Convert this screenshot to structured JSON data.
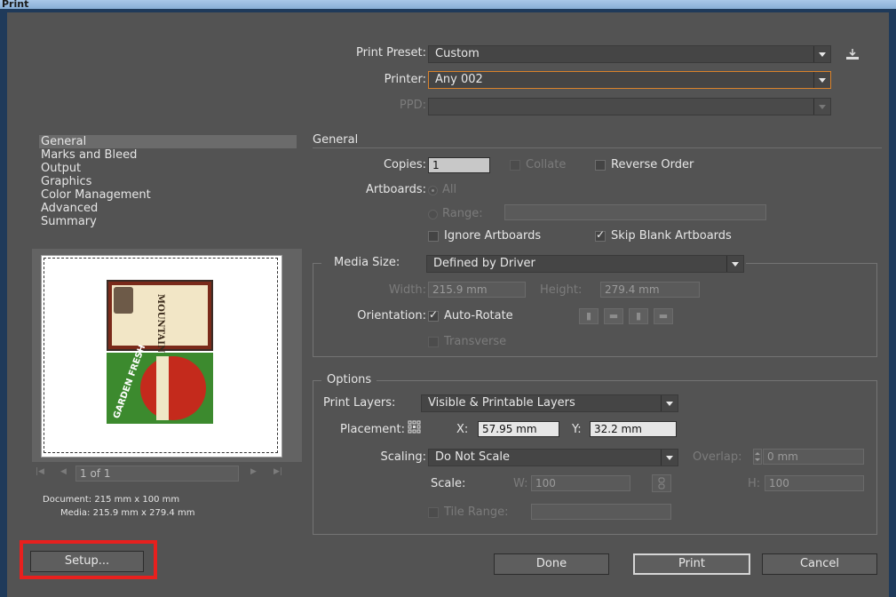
{
  "window": {
    "title": "Print"
  },
  "preset": {
    "label": "Print Preset:",
    "value": "Custom"
  },
  "printer": {
    "label": "Printer:",
    "value": "Any 002"
  },
  "ppd": {
    "label": "PPD:",
    "value": ""
  },
  "nav": {
    "items": [
      "General",
      "Marks and Bleed",
      "Output",
      "Graphics",
      "Color Management",
      "Advanced",
      "Summary"
    ],
    "selected": 0
  },
  "general": {
    "heading": "General",
    "copies_label": "Copies:",
    "copies_value": "1",
    "collate_label": "Collate",
    "reverse_label": "Reverse Order",
    "artboards_label": "Artboards:",
    "all_label": "All",
    "range_label": "Range:",
    "range_value": "",
    "ignore_artboards_label": "Ignore Artboards",
    "skip_blank_label": "Skip Blank Artboards",
    "skip_blank_checked": true
  },
  "media": {
    "label": "Media Size:",
    "value": "Defined by Driver",
    "width_label": "Width:",
    "width_value": "215.9 mm",
    "height_label": "Height:",
    "height_value": "279.4 mm",
    "orientation_label": "Orientation:",
    "autorotate_label": "Auto-Rotate",
    "autorotate_checked": true,
    "transverse_label": "Transverse"
  },
  "options": {
    "heading": "Options",
    "layers_label": "Print Layers:",
    "layers_value": "Visible & Printable Layers",
    "placement_label": "Placement:",
    "x_label": "X:",
    "x_value": "57.95 mm",
    "y_label": "Y:",
    "y_value": "32.2 mm",
    "scaling_label": "Scaling:",
    "scaling_value": "Do Not Scale",
    "overlap_label": "Overlap:",
    "overlap_value": "0 mm",
    "scale_label": "Scale:",
    "w_label": "W:",
    "w_value": "100",
    "h_label": "H:",
    "h_value": "100",
    "tile_label": "Tile Range:",
    "tile_value": ""
  },
  "preview": {
    "page_value": "1 of 1",
    "document_info": "Document: 215 mm x 100 mm",
    "media_info": "Media: 215.9 mm x 279.4 mm",
    "card1_text": "MOUNTAIN BLEND",
    "card2_text": "GARDEN FRESH"
  },
  "buttons": {
    "setup": "Setup...",
    "done": "Done",
    "print": "Print",
    "cancel": "Cancel"
  },
  "colors": {
    "highlight": "#e8201e",
    "printer_focus": "#d9822b",
    "dialog_bg": "#535353"
  }
}
